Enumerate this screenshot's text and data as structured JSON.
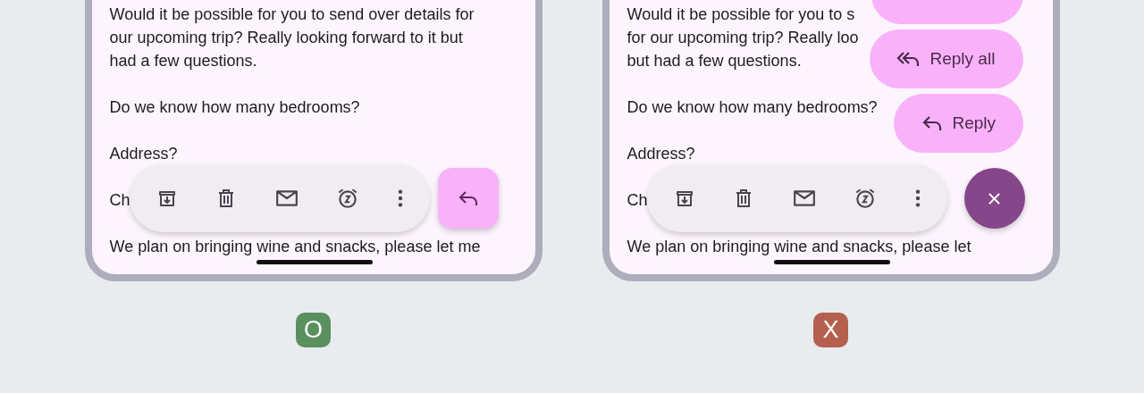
{
  "panels": [
    {
      "verdict": {
        "mark": "O",
        "kind": "good"
      },
      "body": [
        [
          "Would it be possible for you to send over details for",
          "our upcoming trip? Really looking forward to it but",
          "had a few questions."
        ],
        [
          "Do we know how many bedrooms?"
        ],
        [
          "Address?"
        ],
        [
          "Ch"
        ],
        [
          "We plan on bringing wine and snacks, please let me"
        ]
      ],
      "fab": {
        "kind": "reply",
        "expanded": false
      }
    },
    {
      "verdict": {
        "mark": "X",
        "kind": "bad"
      },
      "body": [
        [
          "Would it be possible for you to s",
          "for our upcoming trip? Really loo",
          "but had a few questions."
        ],
        [
          "Do we know how many bedrooms?"
        ],
        [
          "Address?"
        ],
        [
          "Ch"
        ],
        [
          "We plan on bringing wine and snacks, please let"
        ]
      ],
      "fab": {
        "kind": "close",
        "expanded": true
      },
      "menu": [
        {
          "kind": "partial"
        },
        {
          "kind": "reply_all",
          "label": "Reply all"
        },
        {
          "kind": "reply",
          "label": "Reply"
        }
      ]
    }
  ]
}
